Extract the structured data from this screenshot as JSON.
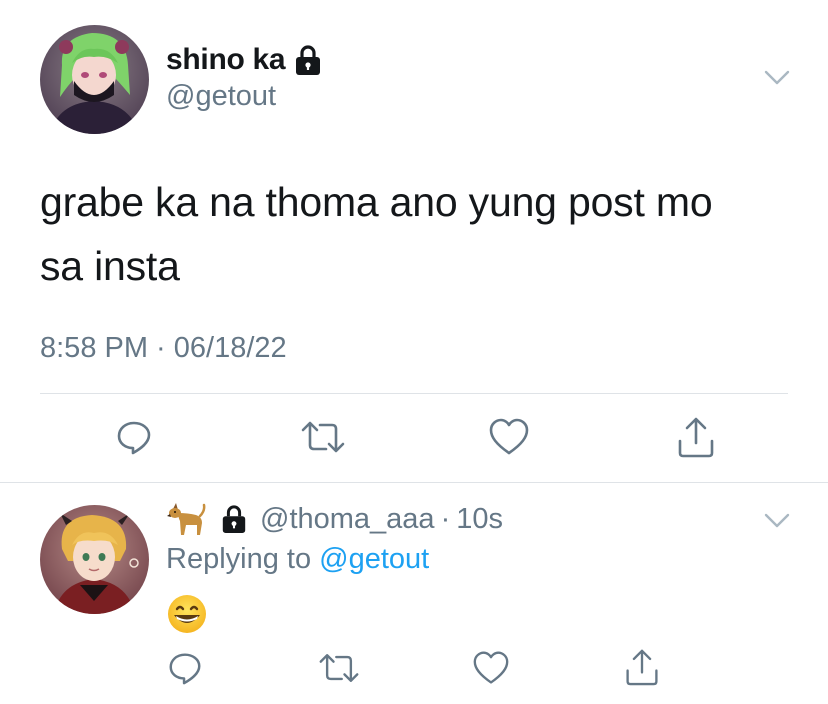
{
  "main_tweet": {
    "display_name": "shino ka",
    "handle": "@getout",
    "text_line1": "grabe ka na thoma ano yung post mo",
    "text_line2": "sa insta",
    "timestamp": "8:58 PM · 06/18/22",
    "icons": [
      "lock-icon",
      "chevron-down-icon",
      "reply-icon",
      "retweet-icon",
      "like-icon",
      "share-icon"
    ]
  },
  "reply_tweet": {
    "handle": "@thoma_aaa",
    "dot": "·",
    "time": "10s",
    "replying_prefix": "Replying to ",
    "replying_handle": "@getout",
    "content_emoji": "grinning-face-with-smiling-eyes",
    "name_emoji": "dog",
    "icons": [
      "dog-emoji",
      "lock-icon",
      "chevron-down-icon",
      "reply-icon",
      "retweet-icon",
      "like-icon",
      "share-icon"
    ]
  },
  "colors": {
    "text_primary": "#14171a",
    "text_secondary": "#657786",
    "link": "#1da1f2",
    "divider": "#dfe3e7",
    "icon": "#657786"
  }
}
